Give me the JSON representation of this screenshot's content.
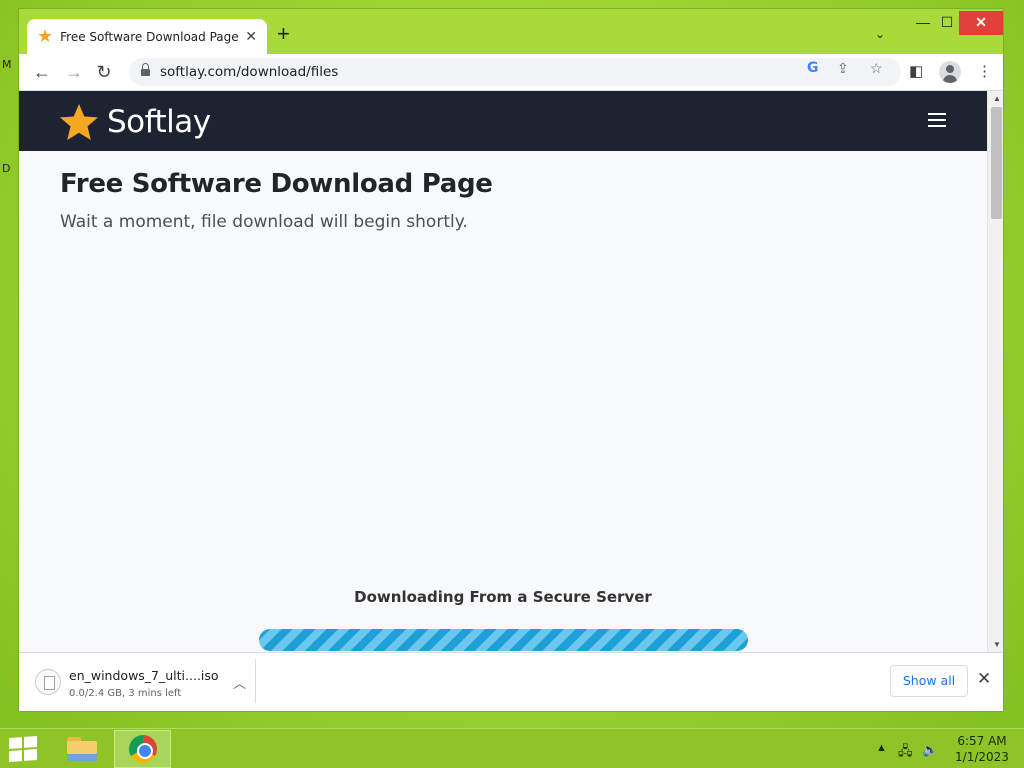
{
  "browser": {
    "tab": {
      "title": "Free Software Download Page - S"
    },
    "address": "softlay.com/download/files"
  },
  "site": {
    "brand": "Softlay",
    "title": "Free Software Download Page",
    "subtitle": "Wait a moment, file download will begin shortly.",
    "download_caption": "Downloading From a Secure Server",
    "progress": 1.0
  },
  "download_shelf": {
    "file_name": "en_windows_7_ulti....iso",
    "status": "0.0/2.4 GB, 3 mins left",
    "show_all": "Show all"
  },
  "taskbar": {
    "time": "6:57 AM",
    "date": "1/1/2023"
  },
  "colors": {
    "brand_star": "#f5a623",
    "site_header": "#1d2330",
    "progress_stripe": "#1e9fd8",
    "desktop": "#9fd634"
  },
  "desktop_edge": [
    "M",
    "D"
  ]
}
